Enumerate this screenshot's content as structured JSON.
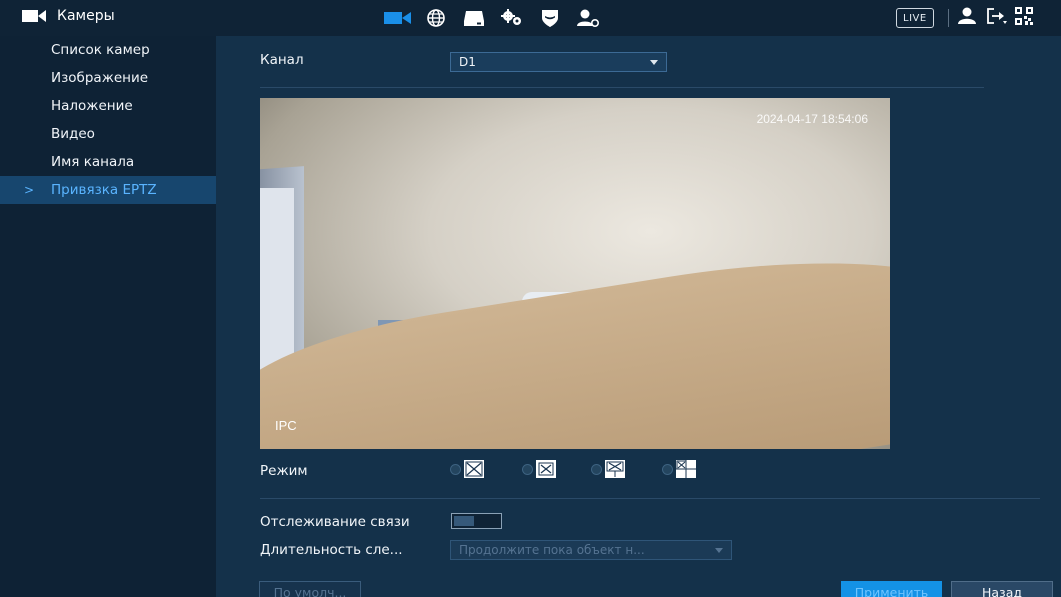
{
  "topbar": {
    "title": "Камеры",
    "live_label": "LIVE",
    "nav_icons": [
      "camera-icon",
      "network-globe-icon",
      "storage-icon",
      "system-gears-icon",
      "security-shield-icon",
      "account-icon"
    ],
    "right_icons": [
      "user-icon",
      "logout-icon",
      "qr-code-icon"
    ],
    "accent": "#1a8fe8"
  },
  "sidebar": {
    "items": [
      {
        "label": "Список камер",
        "active": false
      },
      {
        "label": "Изображение",
        "active": false
      },
      {
        "label": "Наложение",
        "active": false
      },
      {
        "label": "Видео",
        "active": false
      },
      {
        "label": "Имя канала",
        "active": false
      },
      {
        "label": "Привязка EPTZ",
        "active": true
      }
    ]
  },
  "main": {
    "channel_label": "Канал",
    "channel_value": "D1",
    "preview": {
      "timestamp": "2024-04-17 18:54:06",
      "overlay_name": "IPC"
    },
    "mode_label": "Режим",
    "mode_options": [
      "mode-1-icon",
      "mode-2-icon",
      "mode-3-icon",
      "mode-4-icon"
    ],
    "tracking_label": "Отслеживание связи",
    "tracking_enabled": false,
    "duration_label": "Длительность сле...",
    "duration_value": "Продолжите пока объект н..."
  },
  "buttons": {
    "default": "По умолч...",
    "apply": "Применить",
    "back": "Назад"
  }
}
